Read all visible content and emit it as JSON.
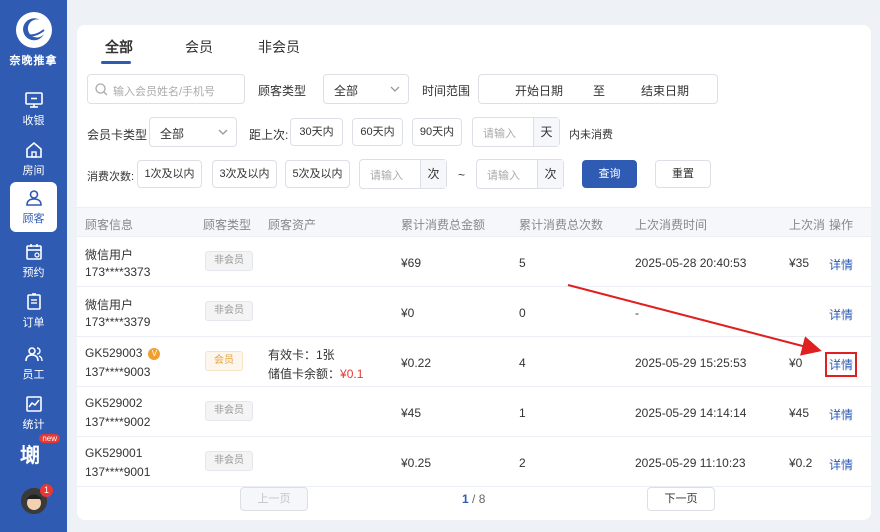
{
  "sidebar": {
    "brand": "奈晚推拿",
    "items": [
      {
        "label": "收银",
        "icon": "cashier-icon"
      },
      {
        "label": "房间",
        "icon": "home-icon"
      },
      {
        "label": "顾客",
        "icon": "user-icon",
        "active": true
      },
      {
        "label": "预约",
        "icon": "calendar-icon"
      },
      {
        "label": "订单",
        "icon": "order-icon"
      },
      {
        "label": "员工",
        "icon": "staff-icon"
      },
      {
        "label": "统计",
        "icon": "chart-icon"
      }
    ],
    "promo_badge": "new",
    "notification_count": "1"
  },
  "tabs": [
    {
      "label": "全部",
      "active": true
    },
    {
      "label": "会员"
    },
    {
      "label": "非会员"
    }
  ],
  "filters": {
    "search_placeholder": "输入会员姓名/手机号",
    "customer_type_label": "顾客类型",
    "customer_type_value": "全部",
    "time_range_label": "时间范围",
    "start_placeholder": "开始日期",
    "range_sep": "至",
    "end_placeholder": "结束日期",
    "card_type_label": "会员卡类型",
    "card_type_value": "全部",
    "distance_label": "距上次:",
    "days_30": "30天内",
    "days_60": "60天内",
    "days_90": "90天内",
    "days_input_placeholder": "请输入",
    "days_unit": "天",
    "days_suffix": "内未消费",
    "count_label": "消费次数:",
    "count_1": "1次及以内",
    "count_3": "3次及以内",
    "count_5": "5次及以内",
    "count_min_placeholder": "请输入",
    "count_unit": "次",
    "count_sep": "~",
    "count_max_placeholder": "请输入",
    "query_button": "查询",
    "reset_button": "重置"
  },
  "table": {
    "headers": [
      "顾客信息",
      "顾客类型",
      "顾客资产",
      "累计消费总金额",
      "累计消费总次数",
      "上次消费时间",
      "上次消",
      "操作"
    ],
    "rows": [
      {
        "name": "微信用户",
        "phone": "173****3373",
        "type": "非会员",
        "asset1": "",
        "asset2_label": "",
        "asset2_value": "",
        "total": "¥69",
        "count": "5",
        "last_time": "2025-05-28 20:40:53",
        "last_amount": "¥35",
        "action": "详情"
      },
      {
        "name": "微信用户",
        "phone": "173****3379",
        "type": "非会员",
        "asset1": "",
        "asset2_label": "",
        "asset2_value": "",
        "total": "¥0",
        "count": "0",
        "last_time": "-",
        "last_amount": "",
        "action": "详情"
      },
      {
        "name": "GK529003",
        "phone": "137****9003",
        "type": "会员",
        "asset1": "有效卡：1张",
        "asset2_label": "储值卡余额：",
        "asset2_value": "¥0.1",
        "total": "¥0.22",
        "count": "4",
        "last_time": "2025-05-29 15:25:53",
        "last_amount": "¥0",
        "action": "详情"
      },
      {
        "name": "GK529002",
        "phone": "137****9002",
        "type": "非会员",
        "asset1": "",
        "asset2_label": "",
        "asset2_value": "",
        "total": "¥45",
        "count": "1",
        "last_time": "2025-05-29 14:14:14",
        "last_amount": "¥45",
        "action": "详情"
      },
      {
        "name": "GK529001",
        "phone": "137****9001",
        "type": "非会员",
        "asset1": "",
        "asset2_label": "",
        "asset2_value": "",
        "total": "¥0.25",
        "count": "2",
        "last_time": "2025-05-29 11:10:23",
        "last_amount": "¥0.2",
        "action": "详情"
      }
    ]
  },
  "pager": {
    "prev": "上一页",
    "current": "1",
    "total": "/ 8",
    "next": "下一页"
  },
  "colors": {
    "primary": "#2f5bb3",
    "highlight": "#e02020"
  }
}
